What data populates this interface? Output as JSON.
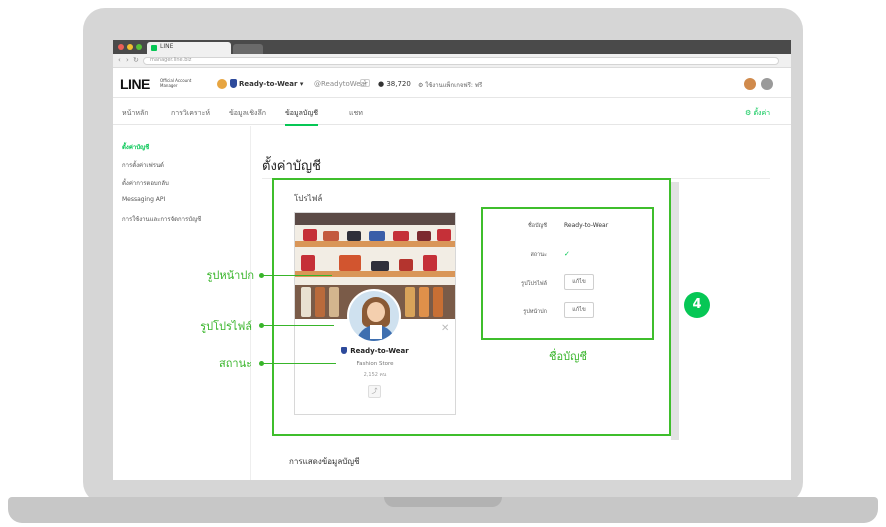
{
  "browser": {
    "tab_title": "LINE",
    "url": "manager.line.biz"
  },
  "header": {
    "logo": "LINE",
    "logo_sub": "Official Account Manager",
    "account_name": "Ready-to-Wear ▾",
    "account_id": "@ReadytoWear",
    "badge": "1",
    "people_count": "● 38,720",
    "plan": "⚙ ใช้งานแพ็กเกจฟรี: ฟรี"
  },
  "topnav": {
    "items": [
      "หน้าหลัก",
      "การวิเคราะห์",
      "ข้อมูลเชิงลึก",
      "ข้อมูลบัญชี",
      "แชท"
    ],
    "active_index": 3,
    "right_label": "⚙ ตั้งค่า"
  },
  "sidebar": {
    "items": [
      "ตั้งค่าบัญชี",
      "การตั้งค่าเฟรนด์",
      "ตั้งค่าการตอบกลับ",
      "Messaging API",
      "การใช้งานและการจัดการบัญชี"
    ],
    "active_index": 0
  },
  "main": {
    "page_title": "ตั้งค่าบัญชี",
    "profile_section_title": "โปรไฟล์",
    "next_section_title": "การแสดงข้อมูลบัญชี"
  },
  "preview": {
    "account_name": "Ready-to-Wear",
    "status": "Fashion Store",
    "friends": "2,152 คน",
    "share": "⤴",
    "close": "✕"
  },
  "form": {
    "rows": [
      {
        "label": "ชื่อบัญชี",
        "value": "Ready-to-Wear"
      },
      {
        "label": "สถานะ",
        "value": "✓"
      },
      {
        "label": "รูปโปรไฟล์",
        "value": "แก้ไข"
      },
      {
        "label": "รูปหน้าปก",
        "value": "แก้ไข"
      }
    ]
  },
  "annotations": {
    "cover": "รูปหน้าปก",
    "profile": "รูปโปรไฟล์",
    "status": "สถานะ",
    "account_name": "ชื่อบัญชี",
    "step": "4"
  },
  "colors": {
    "accent": "#06c755",
    "annotation": "#38b52a"
  }
}
